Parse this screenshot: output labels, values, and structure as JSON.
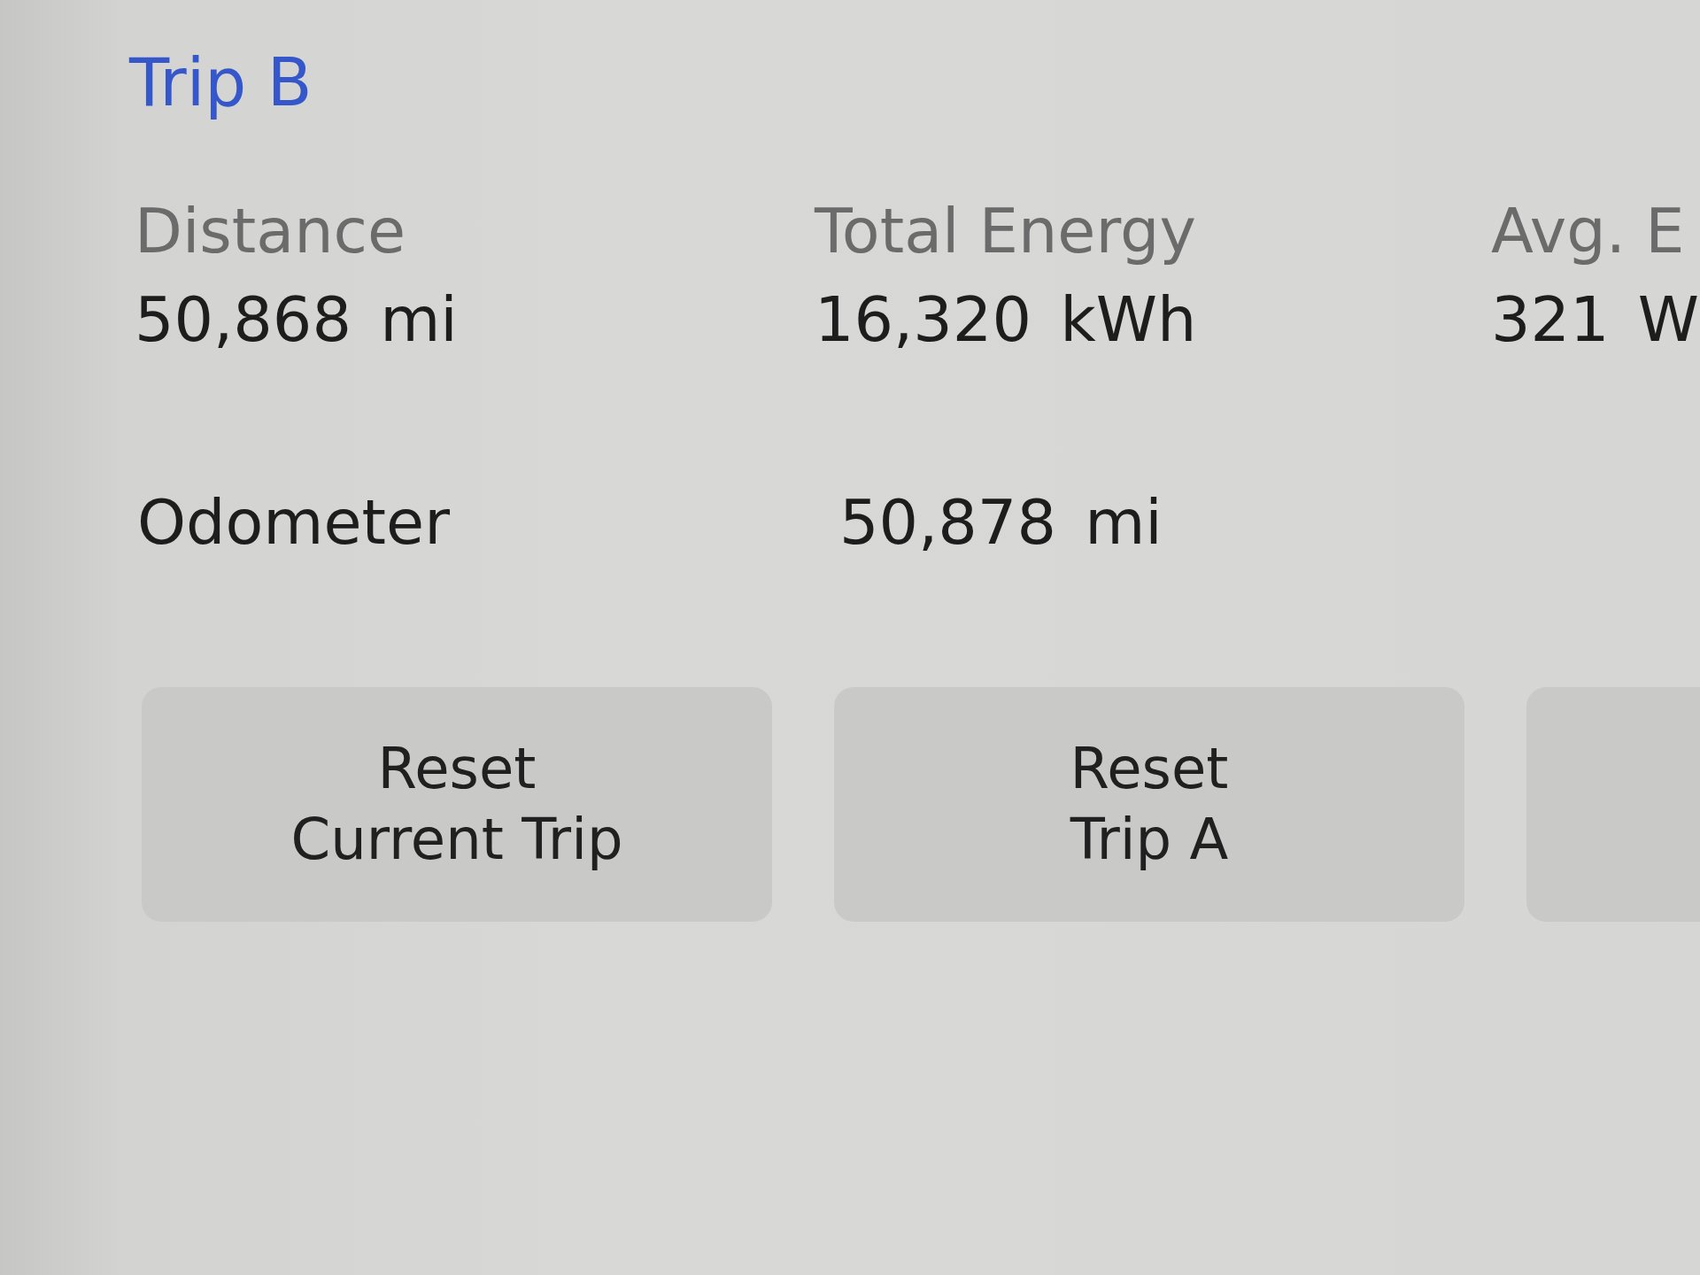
{
  "trip": {
    "title": "Trip B",
    "stats": [
      {
        "label": "Distance",
        "value": "50,868 mi"
      },
      {
        "label": "Total Energy",
        "value": "16,320 kWh"
      },
      {
        "label": "Avg. E",
        "value": "321 W"
      }
    ]
  },
  "odometer": {
    "label": "Odometer",
    "value": "50,878 mi"
  },
  "buttons": [
    {
      "lines": [
        "Reset",
        "Current Trip"
      ],
      "partial": false
    },
    {
      "lines": [
        "Reset",
        "Trip A"
      ],
      "partial": false
    },
    {
      "partial": true
    }
  ]
}
